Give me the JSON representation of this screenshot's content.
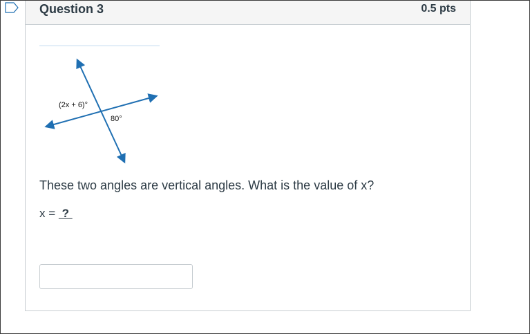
{
  "question": {
    "title": "Question 3",
    "points": "0.5 pts",
    "prompt": "These two angles are vertical angles. What is the value of x?",
    "equation_prefix": "x = ",
    "equation_blank": " ? ",
    "answer_value": "",
    "answer_placeholder": ""
  },
  "diagram": {
    "angle_label_1": "(2x + 6)°",
    "angle_label_2": "80°",
    "line_color": "#1f6fb2"
  },
  "icons": {
    "flag": "flag-icon"
  }
}
